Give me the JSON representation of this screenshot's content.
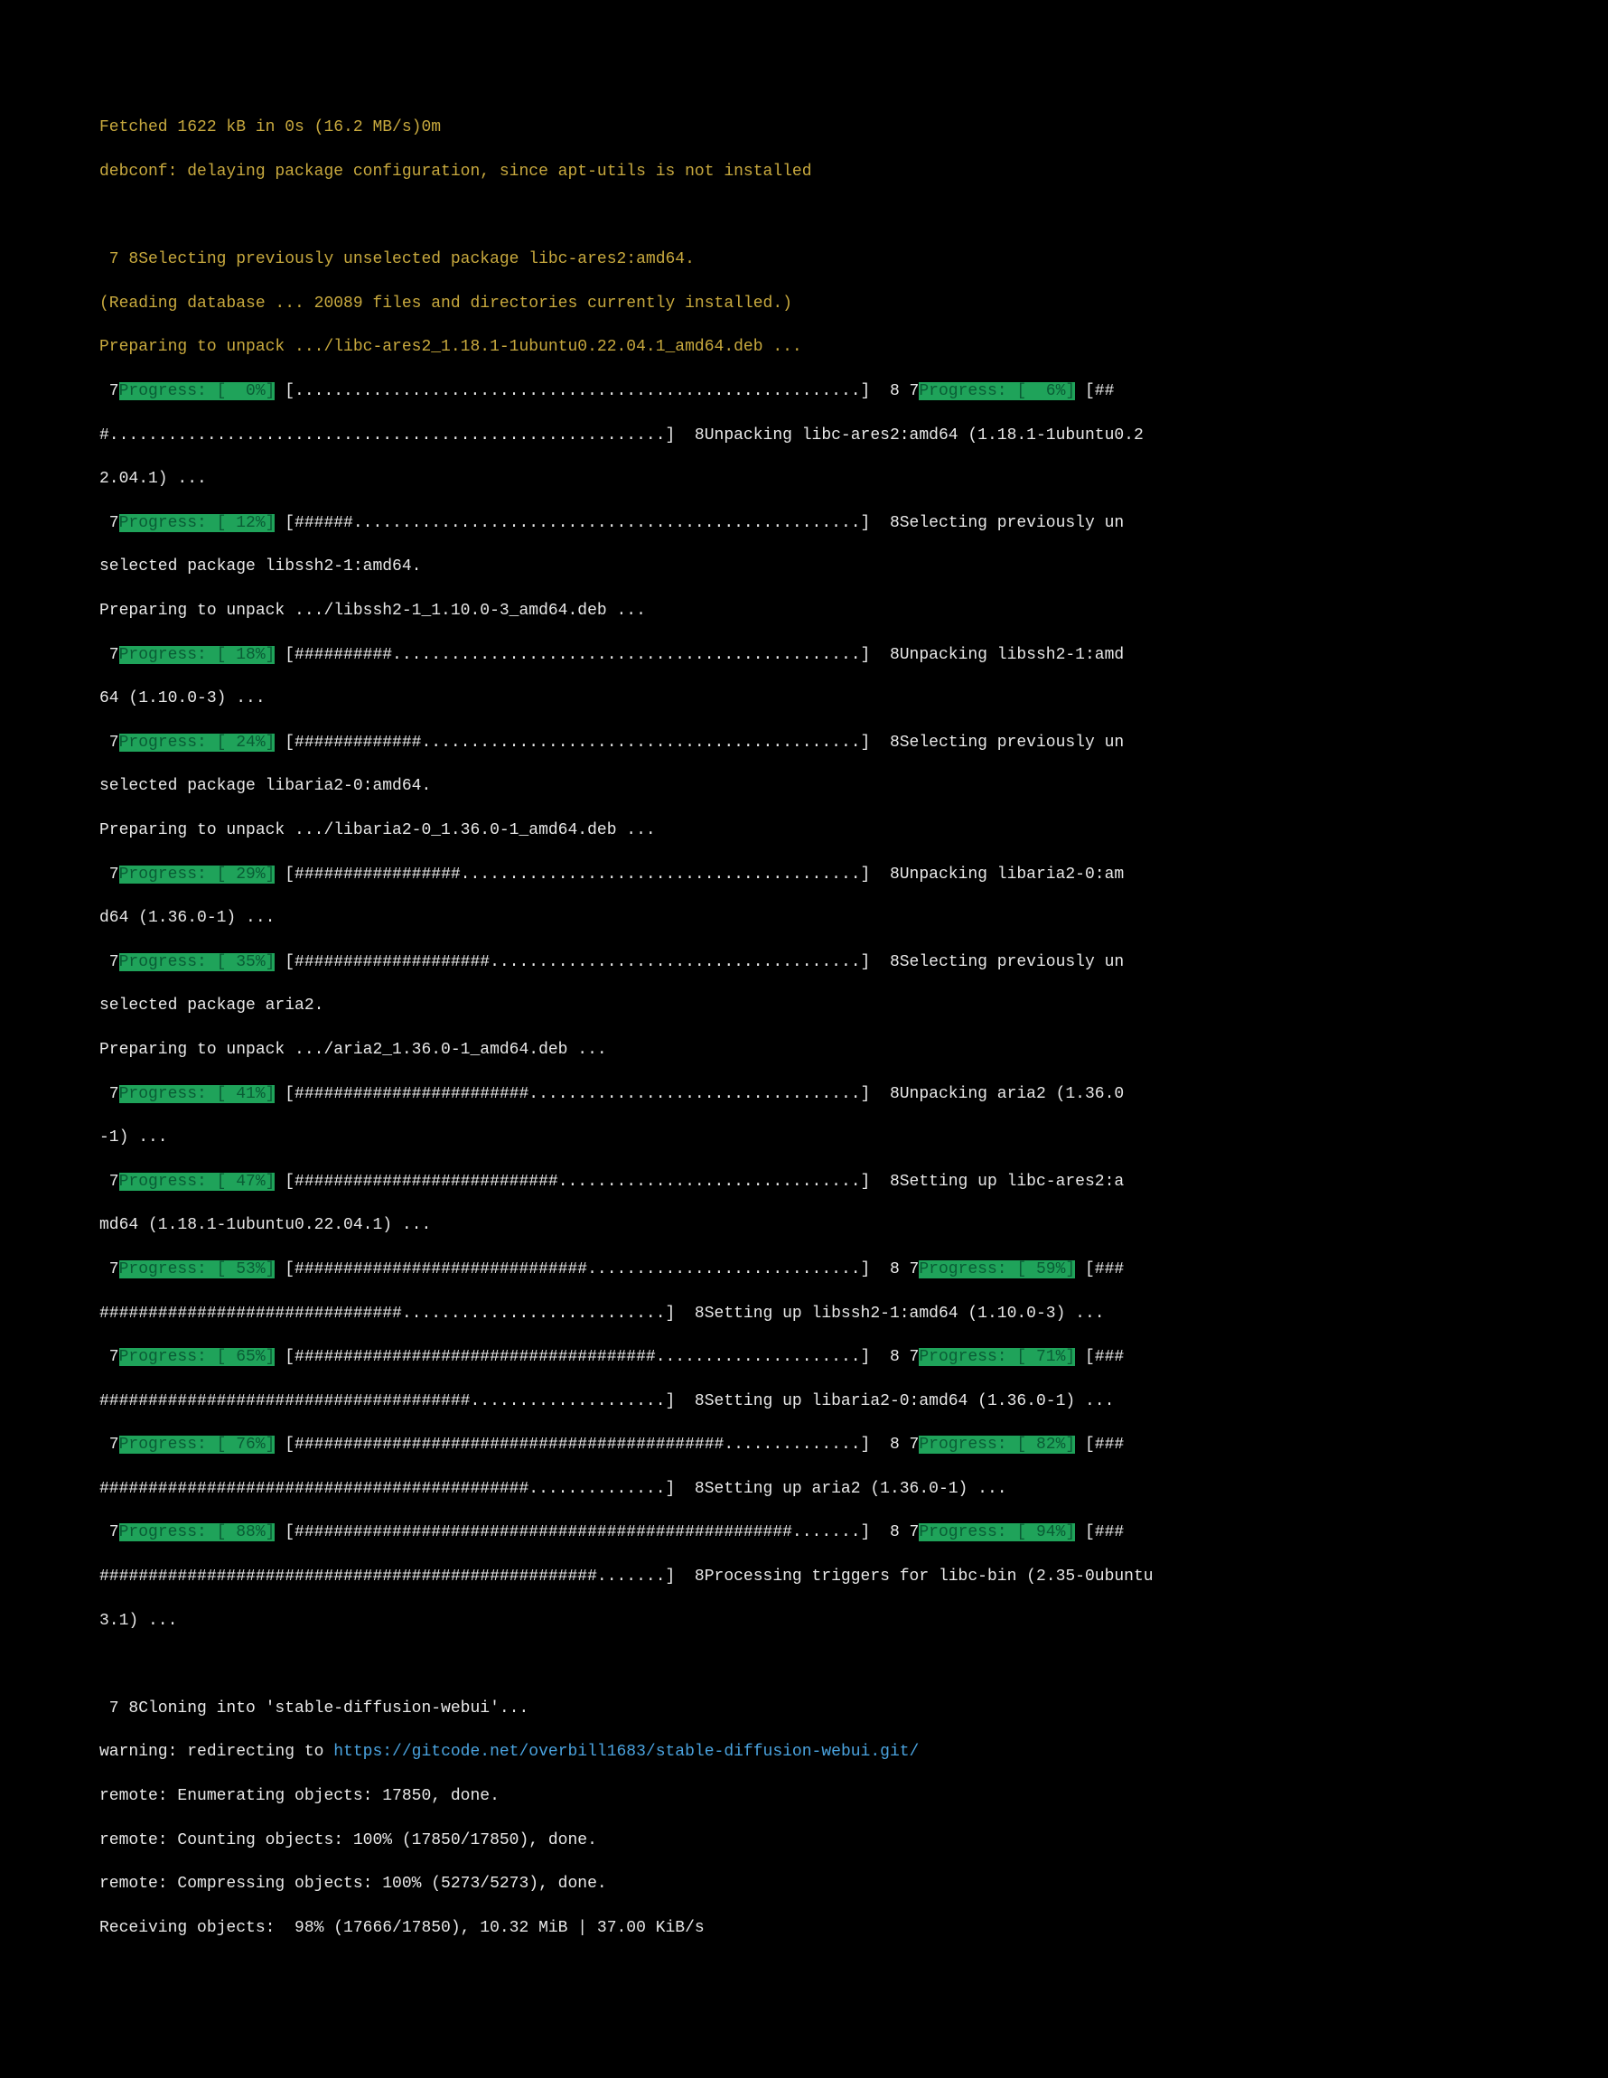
{
  "header": {
    "fetched": "Fetched 1622 kB in 0s (16.2 MB/s)0m",
    "debconf": "debconf: delaying package configuration, since apt-utils is not installed"
  },
  "select": {
    "first": " 7 8Selecting previously unselected package libc-ares2:amd64.",
    "reading": "(Reading database ... 20089 files and directories currently installed.)",
    "preparing1": "Preparing to unpack .../libc-ares2_1.18.1-1ubuntu0.22.04.1_amd64.deb ..."
  },
  "progress": {
    "p0": "Progress: [  0%]",
    "p6": "Progress: [  6%]",
    "p12": "Progress: [ 12%]",
    "p18": "Progress: [ 18%]",
    "p24": "Progress: [ 24%]",
    "p29": "Progress: [ 29%]",
    "p35": "Progress: [ 35%]",
    "p41": "Progress: [ 41%]",
    "p47": "Progress: [ 47%]",
    "p53": "Progress: [ 53%]",
    "p59": "Progress: [ 59%]",
    "p65": "Progress: [ 65%]",
    "p71": "Progress: [ 71%]",
    "p76": "Progress: [ 76%]",
    "p82": "Progress: [ 82%]",
    "p88": "Progress: [ 88%]",
    "p94": "Progress: [ 94%]"
  },
  "bars": {
    "b0": " [..........................................................]  8 7",
    "b6": " [##",
    "b6b": "#.........................................................]  8Unpacking libc-ares2:amd64 (1.18.1-1ubuntu0.2",
    "b6c": "2.04.1) ...",
    "b12": " [######....................................................]  8Selecting previously un",
    "b12b": "selected package libssh2-1:amd64.",
    "prep2": "Preparing to unpack .../libssh2-1_1.10.0-3_amd64.deb ...",
    "b18": " [##########................................................]  8Unpacking libssh2-1:amd",
    "b18b": "64 (1.10.0-3) ...",
    "b24": " [#############.............................................]  8Selecting previously un",
    "b24b": "selected package libaria2-0:amd64.",
    "prep3": "Preparing to unpack .../libaria2-0_1.36.0-1_amd64.deb ...",
    "b29": " [#################.........................................]  8Unpacking libaria2-0:am",
    "b29b": "d64 (1.36.0-1) ...",
    "b35": " [####################......................................]  8Selecting previously un",
    "b35b": "selected package aria2.",
    "prep4": "Preparing to unpack .../aria2_1.36.0-1_amd64.deb ...",
    "b41": " [########################..................................]  8Unpacking aria2 (1.36.0",
    "b41b": "-1) ...",
    "b47": " [###########################...............................]  8Setting up libc-ares2:a",
    "b47b": "md64 (1.18.1-1ubuntu0.22.04.1) ...",
    "b53": " [##############################............................]  8 7",
    "b59": " [###",
    "b59b": "###############################...........................]  8Setting up libssh2-1:amd64 (1.10.0-3) ...",
    "b65": " [#####################################.....................]  8 7",
    "b71": " [###",
    "b71b": "######################################....................]  8Setting up libaria2-0:amd64 (1.36.0-1) ...",
    "b76": " [############################################..............]  8 7",
    "b82": " [###",
    "b82b": "############################################..............]  8Setting up aria2 (1.36.0-1) ...",
    "b88": " [###################################################.......]  8 7",
    "b94": " [###",
    "b94b": "###################################################.......]  8Processing triggers for libc-bin (2.35-0ubuntu",
    "b94c": "3.1) ..."
  },
  "git": {
    "cloning": " 7 8Cloning into 'stable-diffusion-webui'...",
    "warning_prefix": "warning: redirecting to ",
    "url": "https://gitcode.net/overbill1683/stable-diffusion-webui.git/",
    "enum": "remote: Enumerating objects: 17850, done.",
    "count": "remote: Counting objects: 100% (17850/17850), done.",
    "compress": "remote: Compressing objects: 100% (5273/5273), done.",
    "recv": "Receiving objects:  98% (17666/17850), 10.32 MiB | 37.00 KiB/s"
  },
  "prefix7": " 7"
}
